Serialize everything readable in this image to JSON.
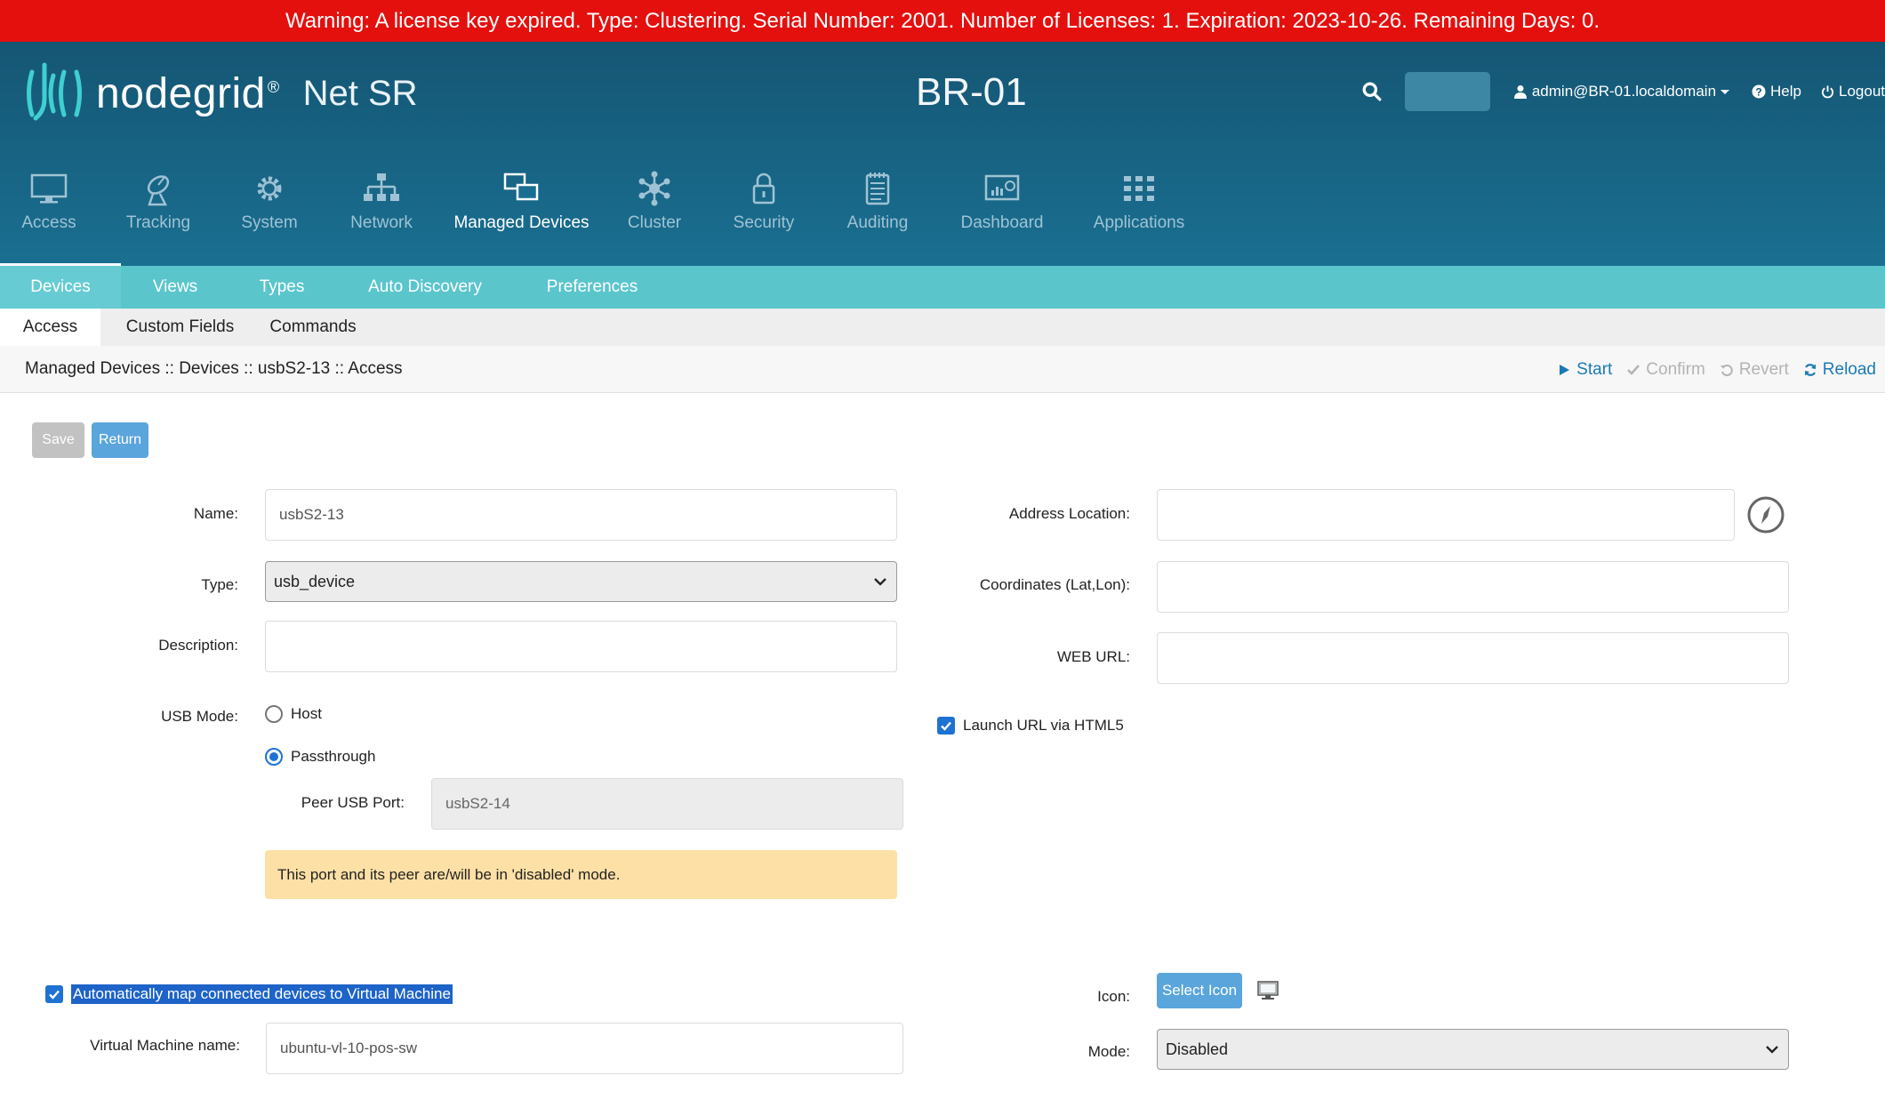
{
  "warning": "Warning: A license key expired. Type: Clustering. Serial Number: 2001. Number of Licenses: 1. Expiration: 2023-10-26. Remaining Days: 0.",
  "brand": {
    "name": "nodegrid",
    "registered": "®",
    "product": "Net SR"
  },
  "hostname": "BR-01",
  "topbar": {
    "user": "admin@BR-01.localdomain",
    "help": "Help",
    "logout": "Logout"
  },
  "mainnav": [
    {
      "label": "Access",
      "icon": "monitor-icon"
    },
    {
      "label": "Tracking",
      "icon": "satellite-dish-icon"
    },
    {
      "label": "System",
      "icon": "gear-icon"
    },
    {
      "label": "Network",
      "icon": "network-tree-icon"
    },
    {
      "label": "Managed Devices",
      "icon": "managed-devices-icon"
    },
    {
      "label": "Cluster",
      "icon": "cluster-icon"
    },
    {
      "label": "Security",
      "icon": "lock-icon"
    },
    {
      "label": "Auditing",
      "icon": "notepad-icon"
    },
    {
      "label": "Dashboard",
      "icon": "dashboard-chart-icon"
    },
    {
      "label": "Applications",
      "icon": "grid-apps-icon"
    }
  ],
  "subnav": [
    "Devices",
    "Views",
    "Types",
    "Auto Discovery",
    "Preferences"
  ],
  "tabs": [
    "Access",
    "Custom Fields",
    "Commands"
  ],
  "breadcrumb": "Managed Devices :: Devices :: usbS2-13 :: Access",
  "actions": {
    "start": "Start",
    "confirm": "Confirm",
    "revert": "Revert",
    "reload": "Reload"
  },
  "buttons": {
    "save": "Save",
    "return": "Return",
    "select_icon": "Select Icon"
  },
  "form": {
    "name_label": "Name:",
    "name_value": "usbS2-13",
    "type_label": "Type:",
    "type_value": "usb_device",
    "description_label": "Description:",
    "description_value": "",
    "usb_mode_label": "USB Mode:",
    "usb_mode_options": [
      "Host",
      "Passthrough"
    ],
    "usb_mode_selected": "Passthrough",
    "peer_label": "Peer USB Port:",
    "peer_value": "usbS2-14",
    "alert": "This port and its peer are/will be in 'disabled' mode.",
    "address_label": "Address Location:",
    "address_value": "",
    "coords_label": "Coordinates (Lat,Lon):",
    "coords_value": "",
    "weburl_label": "WEB URL:",
    "weburl_value": "",
    "html5_label": "Launch URL via HTML5",
    "html5_checked": true,
    "automap_label": "Automatically map connected devices to Virtual Machine",
    "automap_checked": true,
    "vm_label": "Virtual Machine name:",
    "vm_value": "ubuntu-vl-10-pos-sw",
    "icon_label": "Icon:",
    "mode_label": "Mode:",
    "mode_value": "Disabled"
  },
  "colors": {
    "warning_bg": "#e4100e",
    "header_bg": "#155674",
    "subnav_bg": "#5bc5cc",
    "accent": "#1e73d2",
    "alert_bg": "#fde0a6"
  }
}
